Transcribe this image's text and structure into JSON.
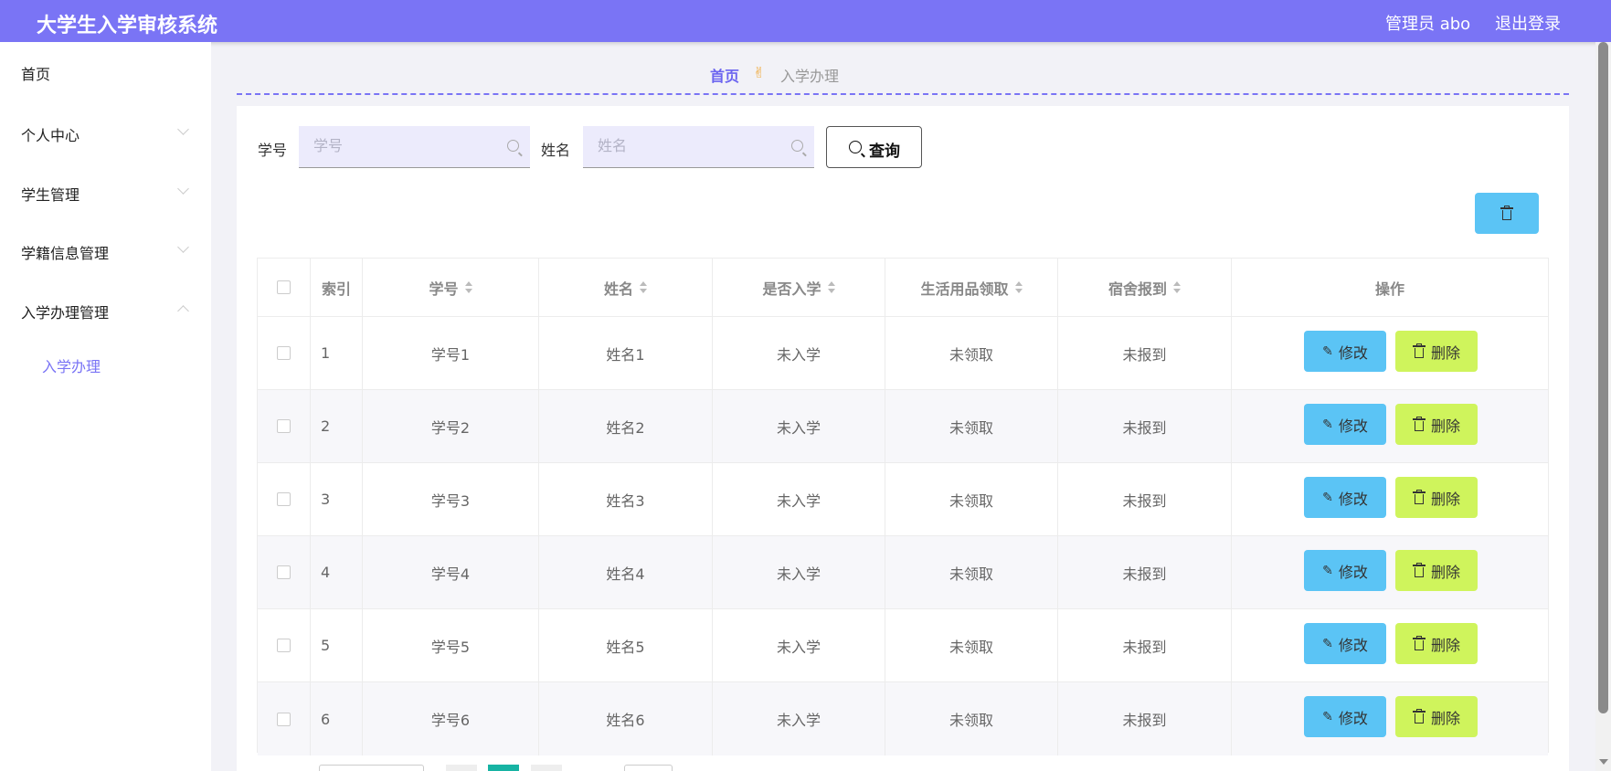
{
  "header": {
    "title": "大学生入学审核系统",
    "user": "管理员 abo",
    "logout": "退出登录"
  },
  "sidebar": {
    "items": [
      {
        "label": "首页"
      },
      {
        "label": "个人中心"
      },
      {
        "label": "学生管理"
      },
      {
        "label": "学籍信息管理"
      },
      {
        "label": "入学办理管理"
      }
    ],
    "subitems": [
      {
        "label": "入学办理"
      }
    ]
  },
  "breadcrumb": {
    "home": "首页",
    "current": "入学办理"
  },
  "search": {
    "id_label": "学号",
    "id_placeholder": "学号",
    "name_label": "姓名",
    "name_placeholder": "姓名",
    "query_label": "查询"
  },
  "table": {
    "headers": {
      "index": "索引",
      "student_id": "学号",
      "name": "姓名",
      "enrolled": "是否入学",
      "supplies": "生活用品领取",
      "dorm": "宿舍报到",
      "actions": "操作"
    },
    "rows": [
      {
        "index": "1",
        "student_id": "学号1",
        "name": "姓名1",
        "enrolled": "未入学",
        "supplies": "未领取",
        "dorm": "未报到"
      },
      {
        "index": "2",
        "student_id": "学号2",
        "name": "姓名2",
        "enrolled": "未入学",
        "supplies": "未领取",
        "dorm": "未报到"
      },
      {
        "index": "3",
        "student_id": "学号3",
        "name": "姓名3",
        "enrolled": "未入学",
        "supplies": "未领取",
        "dorm": "未报到"
      },
      {
        "index": "4",
        "student_id": "学号4",
        "name": "姓名4",
        "enrolled": "未入学",
        "supplies": "未领取",
        "dorm": "未报到"
      },
      {
        "index": "5",
        "student_id": "学号5",
        "name": "姓名5",
        "enrolled": "未入学",
        "supplies": "未领取",
        "dorm": "未报到"
      },
      {
        "index": "6",
        "student_id": "学号6",
        "name": "姓名6",
        "enrolled": "未入学",
        "supplies": "未领取",
        "dorm": "未报到"
      }
    ],
    "edit_label": "修改",
    "delete_label": "删除"
  },
  "colors": {
    "header_bg": "#7a74f5",
    "edit_btn": "#5bc4f5",
    "delete_btn": "#cff45c",
    "accent": "#6b64f0"
  }
}
